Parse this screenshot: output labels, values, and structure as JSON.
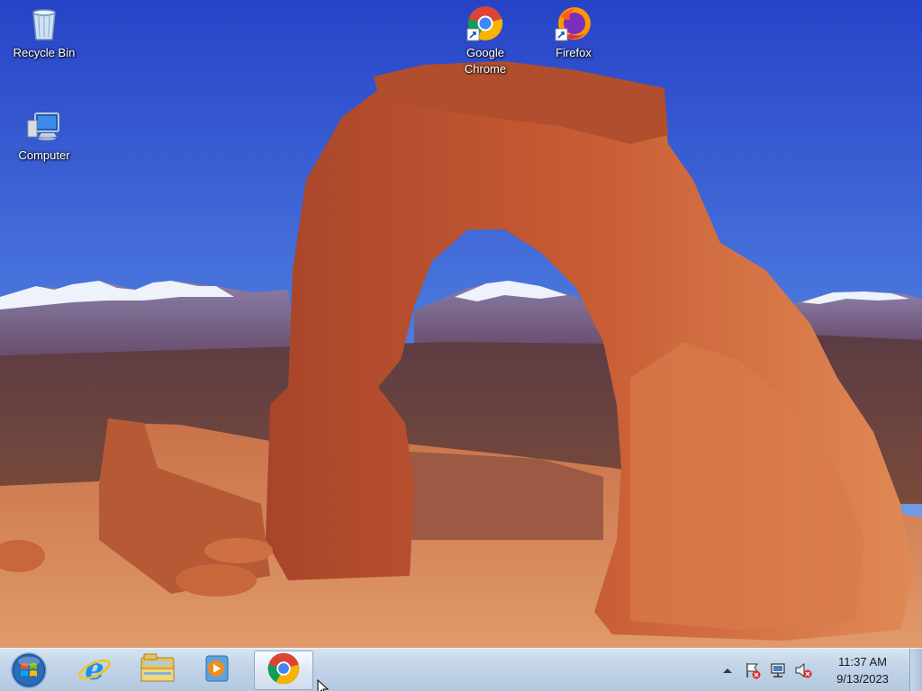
{
  "desktop": {
    "icons": [
      {
        "label": "Recycle Bin",
        "icon": "recycle-bin-icon"
      },
      {
        "label": "Computer",
        "icon": "computer-icon"
      },
      {
        "label": "Google Chrome",
        "icon": "chrome-shortcut-icon"
      },
      {
        "label": "Firefox",
        "icon": "firefox-shortcut-icon"
      }
    ]
  },
  "taskbar": {
    "start": {
      "icon": "windows-start-orb-icon"
    },
    "pinned": [
      {
        "name": "Internet Explorer",
        "icon": "internet-explorer-icon"
      },
      {
        "name": "Windows Explorer",
        "icon": "file-explorer-icon"
      },
      {
        "name": "Windows Media Player",
        "icon": "media-player-icon"
      },
      {
        "name": "Google Chrome",
        "icon": "chrome-icon",
        "active": true
      }
    ],
    "tray": {
      "icons": [
        "show-hidden-icons-chevron",
        "action-center-flag-icon",
        "network-icon",
        "volume-muted-icon"
      ],
      "time": "11:37 AM",
      "date": "9/13/2023"
    }
  },
  "colors": {
    "sky_top": "#2a45c8",
    "sky_bottom": "#6f9ce6",
    "rock": "#c2542e",
    "taskbar": "#c2d4e8"
  }
}
